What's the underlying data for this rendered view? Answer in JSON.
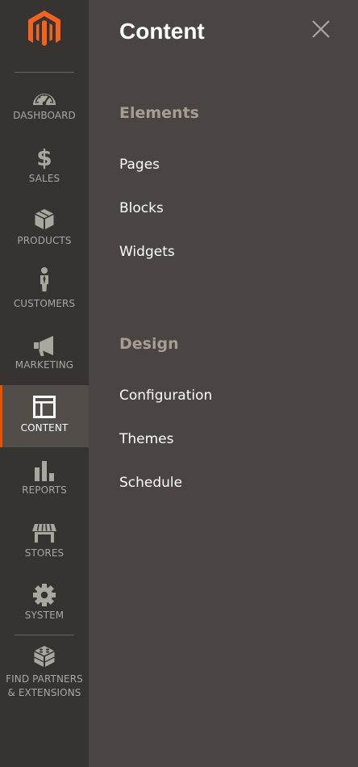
{
  "brand": {
    "accent_color": "#eb5202",
    "logo_icon": "magento-logo"
  },
  "sidebar": {
    "items": [
      {
        "label": "DASHBOARD",
        "icon": "speedometer-icon"
      },
      {
        "label": "SALES",
        "icon": "dollar-icon"
      },
      {
        "label": "PRODUCTS",
        "icon": "cube-icon"
      },
      {
        "label": "CUSTOMERS",
        "icon": "person-icon"
      },
      {
        "label": "MARKETING",
        "icon": "megaphone-icon"
      },
      {
        "label": "CONTENT",
        "icon": "layout-icon",
        "active": true
      },
      {
        "label": "REPORTS",
        "icon": "bar-chart-icon"
      },
      {
        "label": "STORES",
        "icon": "storefront-icon"
      },
      {
        "label": "SYSTEM",
        "icon": "gear-icon"
      },
      {
        "label": "FIND PARTNERS\n& EXTENSIONS",
        "icon": "blocks-icon"
      }
    ]
  },
  "panel": {
    "title": "Content",
    "close_icon": "close-icon",
    "sections": [
      {
        "title": "Elements",
        "links": [
          "Pages",
          "Blocks",
          "Widgets"
        ]
      },
      {
        "title": "Design",
        "links": [
          "Configuration",
          "Themes",
          "Schedule"
        ]
      }
    ]
  },
  "colors": {
    "sidebar_bg": "#373330",
    "panel_bg": "#4a4542",
    "active_item_bg": "#524d49",
    "section_title": "#a79d95"
  }
}
